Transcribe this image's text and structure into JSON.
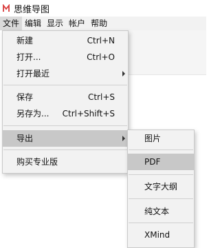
{
  "app": {
    "title": "思维导图",
    "logo_icon": "mindmap-logo-icon"
  },
  "menubar": {
    "items": [
      {
        "label": "文件"
      },
      {
        "label": "编辑"
      },
      {
        "label": "显示"
      },
      {
        "label": "帐户"
      },
      {
        "label": "帮助"
      }
    ]
  },
  "file_menu": {
    "new": {
      "label": "新建",
      "shortcut": "Ctrl+N"
    },
    "open": {
      "label": "打开...",
      "shortcut": "Ctrl+O"
    },
    "open_recent": {
      "label": "打开最近"
    },
    "save": {
      "label": "保存",
      "shortcut": "Ctrl+S"
    },
    "save_as": {
      "label": "另存为...",
      "shortcut": "Ctrl+Shift+S"
    },
    "export": {
      "label": "导出"
    },
    "buy_pro": {
      "label": "购买专业版"
    }
  },
  "export_menu": {
    "items": [
      {
        "label": "图片"
      },
      {
        "label": "PDF"
      },
      {
        "label": "文字大纲"
      },
      {
        "label": "纯文本"
      },
      {
        "label": "XMind"
      }
    ]
  },
  "colors": {
    "menu_bg": "#f2f2f2",
    "highlight": "#c8c8c8",
    "logo_red": "#d83a3a"
  }
}
